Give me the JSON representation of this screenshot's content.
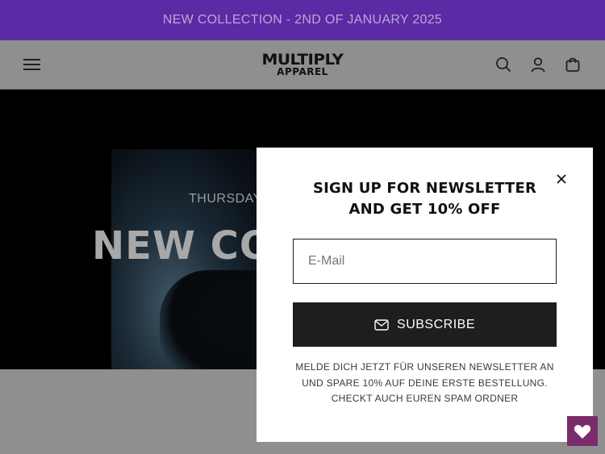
{
  "announcement": {
    "text": "NEW COLLECTION - 2ND OF JANUARY 2025"
  },
  "header": {
    "logo_top": "MULTIPLY",
    "logo_bottom": "APPAREL",
    "icons": [
      "menu-icon",
      "search-icon",
      "account-icon",
      "cart-icon"
    ]
  },
  "hero": {
    "subtitle": "THURSDAY",
    "title": "NEW CO"
  },
  "newsletter": {
    "title_line1": "SIGN UP FOR NEWSLETTER",
    "title_line2": "AND GET 10% OFF",
    "email_placeholder": "E-Mail",
    "subscribe_label": "SUBSCRIBE",
    "disclaimer_line1": "MELDE DICH JETZT FÜR UNSEREN NEWSLETTER AN",
    "disclaimer_line2": "UND SPARE 10% AUF DEINE ERSTE BESTELLUNG.",
    "disclaimer_line3": "CHECKT AUCH EUREN SPAM ORDNER"
  },
  "colors": {
    "announcement_bg": "#5b2aa5",
    "header_bg": "#8f8f8f",
    "button_bg": "#1e1e1e",
    "wishlist_bg": "#7a2b6a"
  }
}
